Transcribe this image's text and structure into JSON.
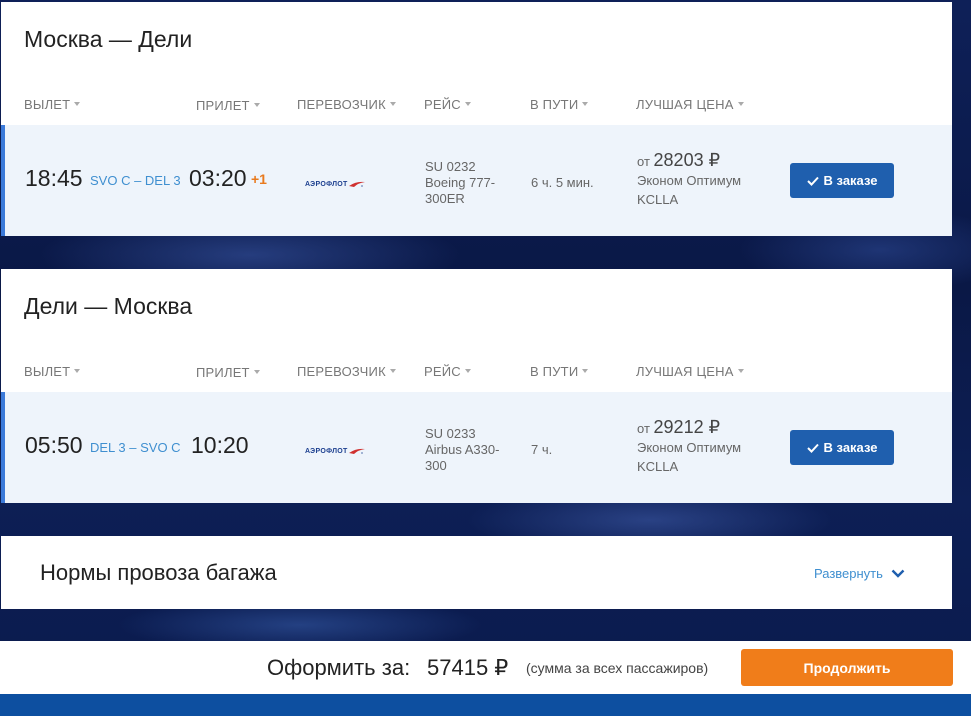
{
  "columns": {
    "departure": "ВЫЛЕТ",
    "arrival": "ПРИЛЕТ",
    "carrier": "ПЕРЕВОЗЧИК",
    "flight": "РЕЙС",
    "duration": "В ПУТИ",
    "best_price": "ЛУЧШАЯ ЦЕНА"
  },
  "routes": [
    {
      "title": "Москва — Дели",
      "dep_time": "18:45",
      "airports": "SVO C – DEL 3",
      "arr_time": "03:20",
      "plus_day": "+1",
      "airline_logo_text": "АЭРОФЛОТ",
      "flight_number": "SU 0232",
      "aircraft": "Boeing 777-300ER",
      "duration": "6 ч. 5 мин.",
      "price_prefix": "от",
      "price": "28203 ₽",
      "fare_class": "Эконом Оптимум",
      "fare_code": "KCLLA",
      "button": "В заказе"
    },
    {
      "title": "Дели — Москва",
      "dep_time": "05:50",
      "airports": "DEL 3 – SVO C",
      "arr_time": "10:20",
      "plus_day": "",
      "airline_logo_text": "АЭРОФЛОТ",
      "flight_number": "SU 0233",
      "aircraft": "Airbus A330-300",
      "duration": "7 ч.",
      "price_prefix": "от",
      "price": "29212 ₽",
      "fare_class": "Эконом Оптимум",
      "fare_code": "KCLLA",
      "button": "В заказе"
    }
  ],
  "baggage": {
    "title": "Нормы провоза багажа",
    "expand_label": "Развернуть"
  },
  "footer": {
    "label": "Оформить за:",
    "total": "57415 ₽",
    "note": "(сумма за всех пассажиров)",
    "continue_button": "Продолжить"
  },
  "colors": {
    "accent_blue": "#1f5fae",
    "link_blue": "#3f8fd0",
    "orange": "#f07d1a"
  }
}
